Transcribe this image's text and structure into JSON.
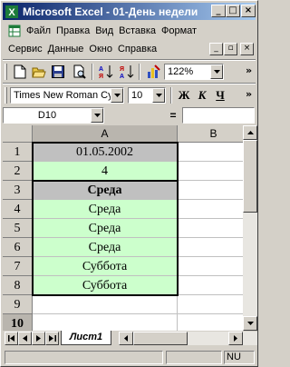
{
  "window": {
    "title": "Microsoft Excel - 01-День недели",
    "minimize_glyph": "_",
    "maximize_glyph": "□",
    "close_glyph": "×"
  },
  "menu": {
    "items": [
      {
        "label": "Файл"
      },
      {
        "label": "Правка"
      },
      {
        "label": "Вид"
      },
      {
        "label": "Вставка"
      },
      {
        "label": "Формат"
      },
      {
        "label": "Сервис"
      },
      {
        "label": "Данные"
      },
      {
        "label": "Окно"
      },
      {
        "label": "Справка"
      }
    ],
    "doc_minimize_glyph": "_",
    "doc_restore_glyph": "▫",
    "doc_close_glyph": "×"
  },
  "standard_toolbar": {
    "zoom": "122%",
    "overflow": "»"
  },
  "format_toolbar": {
    "font": "Times New Roman Cyr",
    "size": "10",
    "bold": "Ж",
    "italic": "К",
    "underline": "Ч",
    "overflow": "»"
  },
  "formula_bar": {
    "name_box": "D10",
    "equals": "=",
    "formula": ""
  },
  "grid": {
    "columns": [
      "A",
      "B"
    ],
    "rows": [
      {
        "num": "1",
        "a": "01.05.2002"
      },
      {
        "num": "2",
        "a": "4"
      },
      {
        "num": "3",
        "a": "Среда"
      },
      {
        "num": "4",
        "a": "Среда"
      },
      {
        "num": "5",
        "a": "Среда"
      },
      {
        "num": "6",
        "a": "Среда"
      },
      {
        "num": "7",
        "a": "Суббота"
      },
      {
        "num": "8",
        "a": "Суббота"
      },
      {
        "num": "9",
        "a": ""
      },
      {
        "num": "10",
        "a": ""
      }
    ]
  },
  "sheets": {
    "active": "Лист1"
  },
  "status": {
    "num": "NU"
  }
}
